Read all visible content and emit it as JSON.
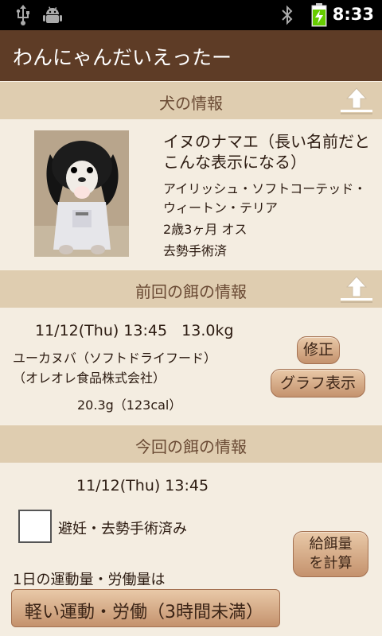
{
  "status_bar": {
    "time": "8:33",
    "icons": [
      "usb-icon",
      "android-debug-icon",
      "bluetooth-icon",
      "battery-charging-icon"
    ]
  },
  "app_title": "わんにゃんだいえったー",
  "dog_section": {
    "header": "犬の情報",
    "name": "イヌのナマエ（長い名前だとこんな表示になる）",
    "breed": "アイリッシュ・ソフトコーテッド・ウィートン・テリア",
    "age_sex": "2歳3ヶ月  オス",
    "neutered": "去勢手術済"
  },
  "last_feed_section": {
    "header": "前回の餌の情報",
    "datetime_weight": "11/12(Thu) 13:45   13.0kg",
    "food_name": "ユーカヌバ（ソフトドライフード）（オレオレ食品株式会社）",
    "amount": "20.3g（123cal）",
    "edit_button": "修正",
    "graph_button": "グラフ表示"
  },
  "current_feed_section": {
    "header": "今回の餌の情報",
    "datetime": "11/12(Thu) 13:45",
    "spay_checkbox_label": "避妊・去勢手術済み",
    "calc_button_line1": "給餌量",
    "calc_button_line2": "を計算",
    "exercise_label": "1日の運動量・労働量は",
    "exercise_select": "軽い運動・労働（3時間未満）"
  }
}
